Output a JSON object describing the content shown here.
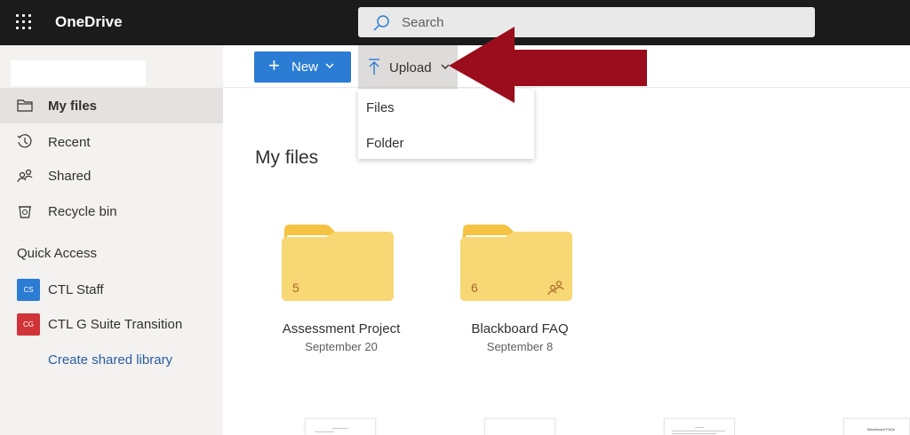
{
  "app": {
    "title": "OneDrive"
  },
  "search": {
    "placeholder": "Search"
  },
  "sidebar": {
    "items": [
      {
        "label": "My files",
        "icon": "folder-icon",
        "active": true
      },
      {
        "label": "Recent",
        "icon": "history-icon",
        "active": false
      },
      {
        "label": "Shared",
        "icon": "people-icon",
        "active": false
      },
      {
        "label": "Recycle bin",
        "icon": "recycle-bin-icon",
        "active": false
      }
    ],
    "quick_access": {
      "title": "Quick Access",
      "items": [
        {
          "badge": "CS",
          "label": "CTL Staff",
          "color": "#2b7cd3"
        },
        {
          "badge": "CG",
          "label": "CTL G Suite Transition",
          "color": "#d13438"
        }
      ],
      "create_label": "Create shared library"
    }
  },
  "toolbar": {
    "new_label": "New",
    "upload_label": "Upload",
    "upload_menu": [
      "Files",
      "Folder"
    ]
  },
  "main": {
    "title": "My files",
    "folders": [
      {
        "name": "Assessment Project",
        "date": "September 20",
        "count": "5",
        "shared": false
      },
      {
        "name": "Blackboard FAQ",
        "date": "September 8",
        "count": "6",
        "shared": true
      }
    ],
    "thumbnails": [
      {
        "caption": ""
      },
      {
        "caption": ""
      },
      {
        "caption": ""
      },
      {
        "caption": "Blackboard FAQs"
      }
    ]
  },
  "colors": {
    "accent": "#2b7cd3",
    "topbar": "#1b1b1b",
    "annotation_arrow": "#9b0d1c",
    "folder": "#f8d775"
  }
}
